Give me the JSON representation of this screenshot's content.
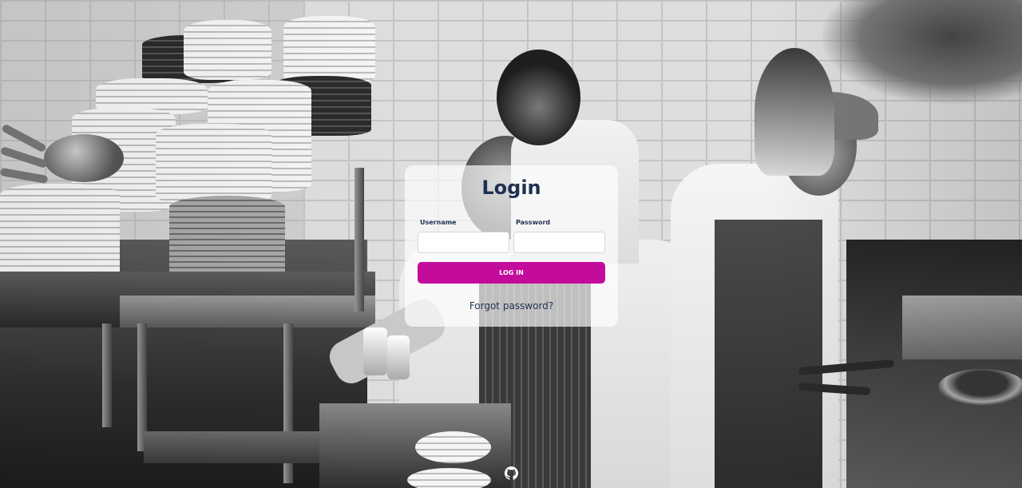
{
  "login": {
    "title": "Login",
    "username_label": "Username",
    "username_value": "",
    "password_label": "Password",
    "password_value": "",
    "submit_label": "LOG IN",
    "forgot_label": "Forgot password?"
  },
  "footer": {
    "icon": "github-icon"
  },
  "colors": {
    "accent": "#c40c9c",
    "heading": "#1f3150"
  }
}
